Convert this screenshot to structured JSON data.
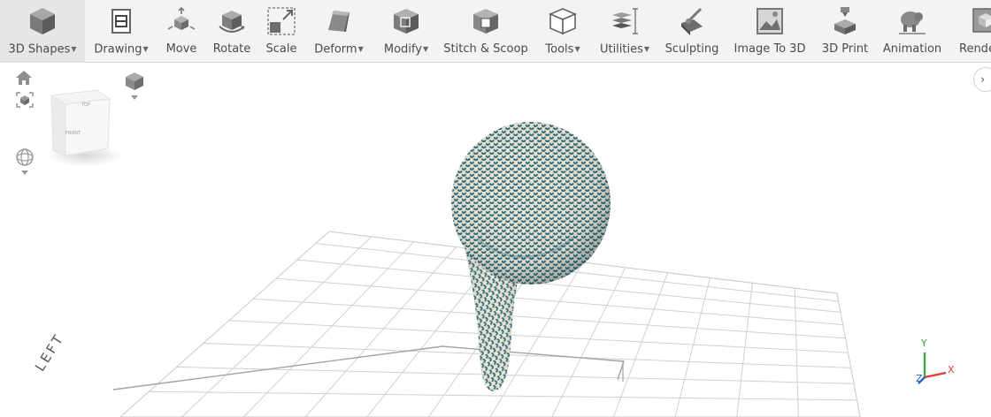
{
  "toolbar": {
    "items": [
      {
        "label": "3D Shapes",
        "dropdown": true,
        "icon": "cube-icon",
        "active": true
      },
      {
        "label": "Drawing",
        "dropdown": true,
        "icon": "drawing-icon"
      },
      {
        "label": "Move",
        "dropdown": false,
        "icon": "move-icon"
      },
      {
        "label": "Rotate",
        "dropdown": false,
        "icon": "rotate-icon"
      },
      {
        "label": "Scale",
        "dropdown": false,
        "icon": "scale-icon"
      },
      {
        "label": "Deform",
        "dropdown": true,
        "icon": "deform-icon"
      },
      {
        "label": "Modify",
        "dropdown": true,
        "icon": "modify-icon"
      },
      {
        "label": "Stitch & Scoop",
        "dropdown": false,
        "icon": "stitch-scoop-icon"
      },
      {
        "label": "Tools",
        "dropdown": true,
        "icon": "tools-icon"
      },
      {
        "label": "Utilities",
        "dropdown": true,
        "icon": "utilities-icon"
      },
      {
        "label": "Sculpting",
        "dropdown": false,
        "icon": "sculpting-icon"
      },
      {
        "label": "Image To 3D",
        "dropdown": false,
        "icon": "image-to-3d-icon"
      },
      {
        "label": "3D Print",
        "dropdown": false,
        "icon": "3d-print-icon"
      },
      {
        "label": "Animation",
        "dropdown": false,
        "icon": "animation-icon"
      },
      {
        "label": "Render",
        "dropdown": false,
        "icon": "render-icon"
      }
    ]
  },
  "viewcube": {
    "front_label": "FRONT",
    "top_label": "TOP"
  },
  "view_label": "LEFT",
  "axes": {
    "x": "X",
    "y": "Y",
    "z": "Z",
    "x_color": "#e53935",
    "y_color": "#43a047",
    "z_color": "#1e63c9"
  },
  "model": {
    "color": "#2d6e80",
    "base_color": "#efe4d2"
  },
  "icons": {
    "home": "home-icon",
    "fit": "fit-view-icon",
    "projection": "perspective-icon",
    "orbit": "orbit-icon",
    "panel": "chevron-right-icon"
  },
  "side_toggle_glyph": "›"
}
